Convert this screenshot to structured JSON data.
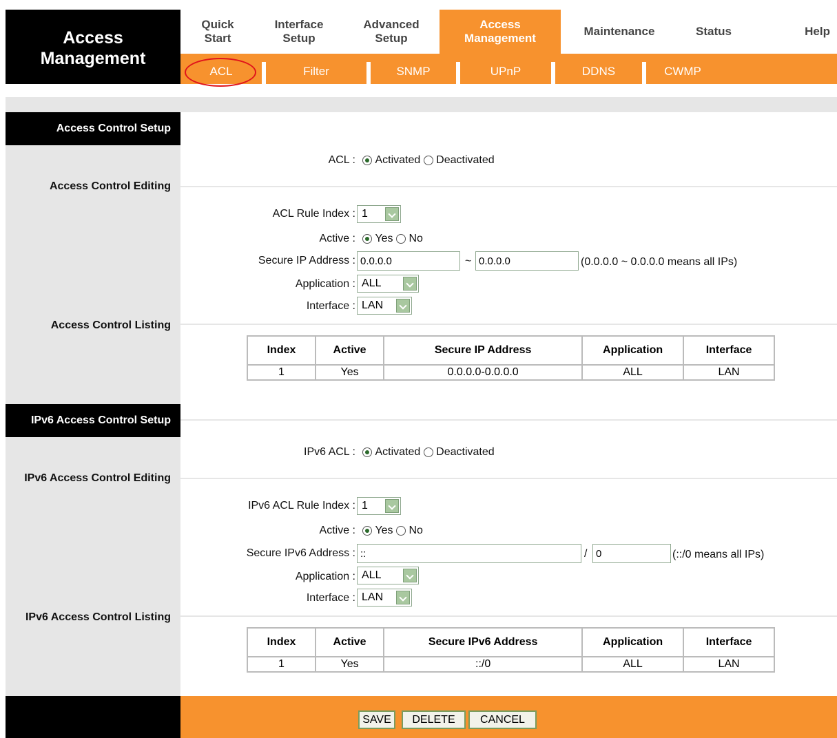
{
  "header": {
    "title_line1": "Access",
    "title_line2": "Management"
  },
  "menu": [
    {
      "label1": "Quick",
      "label2": "Start"
    },
    {
      "label1": "Interface",
      "label2": "Setup"
    },
    {
      "label1": "Advanced",
      "label2": "Setup"
    },
    {
      "label1": "Access",
      "label2": "Management",
      "active": true
    },
    {
      "label1": "Maintenance",
      "label2": ""
    },
    {
      "label1": "Status",
      "label2": ""
    },
    {
      "label1": "Help",
      "label2": ""
    }
  ],
  "submenu": [
    "ACL",
    "Filter",
    "SNMP",
    "UPnP",
    "DDNS",
    "CWMP"
  ],
  "acl": {
    "section_title": "Access Control Setup",
    "editing_label": "Access Control Editing",
    "listing_label": "Access Control Listing",
    "acl_label": "ACL :",
    "activated": "Activated",
    "deactivated": "Deactivated",
    "rule_index_label": "ACL Rule Index :",
    "rule_index_value": "1",
    "active_label": "Active :",
    "yes": "Yes",
    "no": "No",
    "secure_ip_label": "Secure IP Address :",
    "ip_start": "0.0.0.0",
    "tilde": "~",
    "ip_end": "0.0.0.0",
    "ip_hint": "(0.0.0.0 ~ 0.0.0.0 means all IPs)",
    "application_label": "Application :",
    "application_value": "ALL",
    "interface_label": "Interface :",
    "interface_value": "LAN",
    "table": {
      "headers": [
        "Index",
        "Active",
        "Secure IP Address",
        "Application",
        "Interface"
      ],
      "rows": [
        [
          "1",
          "Yes",
          "0.0.0.0-0.0.0.0",
          "ALL",
          "LAN"
        ]
      ]
    }
  },
  "ipv6": {
    "section_title": "IPv6 Access Control Setup",
    "editing_label": "IPv6 Access Control Editing",
    "listing_label": "IPv6 Access Control Listing",
    "acl_label": "IPv6 ACL :",
    "activated": "Activated",
    "deactivated": "Deactivated",
    "rule_index_label": "IPv6 ACL Rule Index :",
    "rule_index_value": "1",
    "active_label": "Active :",
    "yes": "Yes",
    "no": "No",
    "secure_ip_label": "Secure IPv6 Address :",
    "ip_value": "::",
    "slash": "/",
    "prefix_value": "0",
    "ip_hint": "(::/0 means all IPs)",
    "application_label": "Application :",
    "application_value": "ALL",
    "interface_label": "Interface :",
    "interface_value": "LAN",
    "table": {
      "headers": [
        "Index",
        "Active",
        "Secure IPv6 Address",
        "Application",
        "Interface"
      ],
      "rows": [
        [
          "1",
          "Yes",
          "::/0",
          "ALL",
          "LAN"
        ]
      ]
    }
  },
  "footer": {
    "save": "SAVE",
    "delete": "DELETE",
    "cancel": "CANCEL"
  },
  "colors": {
    "accent": "#f7922e",
    "panel": "#e6e6e6",
    "header": "#000000"
  }
}
